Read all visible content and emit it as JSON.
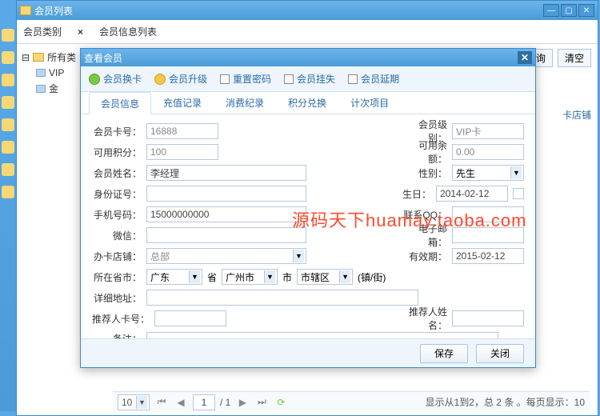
{
  "outer": {
    "title": "会员列表",
    "tabs": [
      "会员类别",
      "会员信息列表"
    ],
    "tree": {
      "root": "所有类",
      "children": [
        "VIP",
        "金"
      ]
    },
    "right_buttons": [
      "询",
      "清空"
    ],
    "card_shop_label": "卡店铺"
  },
  "dialog": {
    "title": "查看会员",
    "toolbar": [
      "会员换卡",
      "会员升级",
      "重置密码",
      "会员挂失",
      "会员延期"
    ],
    "tabs": [
      "会员信息",
      "充值记录",
      "消费纪录",
      "积分兑换",
      "计次项目"
    ],
    "labels": {
      "card_no": "会员卡号：",
      "level": "会员级别：",
      "points": "可用积分：",
      "balance": "可用余额：",
      "name": "会员姓名：",
      "gender": "性别：",
      "id_no": "身份证号：",
      "birthday": "生日：",
      "phone": "手机号码：",
      "qq": "联系QQ：",
      "wechat": "微信：",
      "email": "电子邮箱：",
      "shop": "办卡店铺：",
      "expiry": "有效期：",
      "province": "所在省市：",
      "prov_suffix": "省",
      "city_suffix": "市",
      "district_suffix": "(镇/街)",
      "address": "详细地址：",
      "ref_card": "推荐人卡号：",
      "ref_name": "推荐人姓名：",
      "remark": "备注："
    },
    "values": {
      "card_no": "16888",
      "level": "VIP卡",
      "points": "100",
      "balance": "0.00",
      "name": "李经理",
      "gender": "先生",
      "birthday": "2014-02-12",
      "phone": "15000000000",
      "shop": "总部",
      "expiry": "2015-02-12",
      "province": "广东",
      "city": "广州市",
      "district": "市辖区"
    },
    "buttons": {
      "save": "保存",
      "close": "关闭"
    }
  },
  "pager": {
    "size": "10",
    "page": "1",
    "total_pages": "/ 1",
    "info": "显示从1到2，总 2 条 。每页显示：10"
  },
  "watermark": "源码天下huamay.taoba.com"
}
